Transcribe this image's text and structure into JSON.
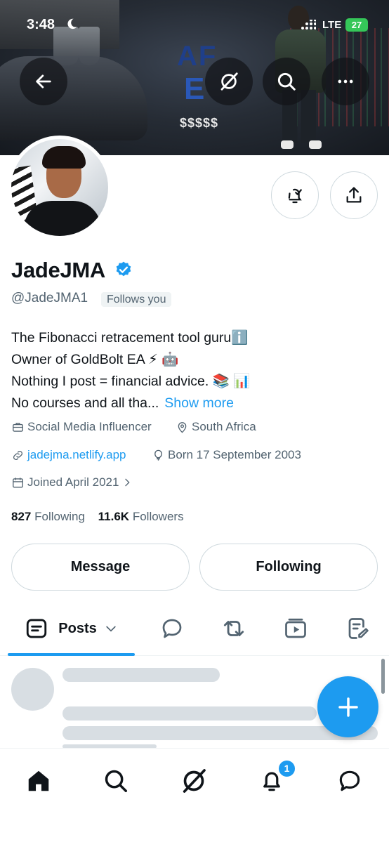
{
  "status_bar": {
    "time": "3:48",
    "network": "LTE",
    "battery": "27"
  },
  "banner": {
    "logo_top": "AF",
    "logo_bottom": "E",
    "caption": "$$$$$"
  },
  "profile": {
    "name": "JadeJMA",
    "handle": "@JadeJMA1",
    "follows_you": "Follows you",
    "bio_lines": [
      "The Fibonacci retracement tool guruℹ️",
      "Owner of GoldBolt EA ⚡ 🤖",
      "Nothing I post = financial advice. 📚 📊",
      "No courses and all tha..."
    ],
    "show_more": "Show more",
    "category": "Social Media Influencer",
    "location": "South Africa",
    "website": "jadejma.netlify.app",
    "birthday": "Born 17 September 2003",
    "joined": "Joined April 2021",
    "following_count": "827",
    "following_label": "Following",
    "followers_count": "11.6K",
    "followers_label": "Followers"
  },
  "buttons": {
    "message": "Message",
    "following": "Following"
  },
  "tabs": {
    "active_label": "Posts"
  },
  "notifications_badge": "1",
  "colors": {
    "accent": "#1d9bf0",
    "text_primary": "#0f1419",
    "text_secondary": "#536471",
    "border": "#cfd9de"
  },
  "icons": [
    "back-arrow-icon",
    "grok-icon",
    "search-icon",
    "more-icon",
    "bell-check-icon",
    "share-icon",
    "verified-icon",
    "briefcase-icon",
    "location-icon",
    "link-icon",
    "balloon-icon",
    "calendar-icon",
    "posts-icon",
    "replies-icon",
    "reposts-icon",
    "media-icon",
    "articles-icon",
    "plus-icon",
    "home-icon",
    "grok-nav-icon",
    "bell-icon",
    "messages-icon"
  ]
}
